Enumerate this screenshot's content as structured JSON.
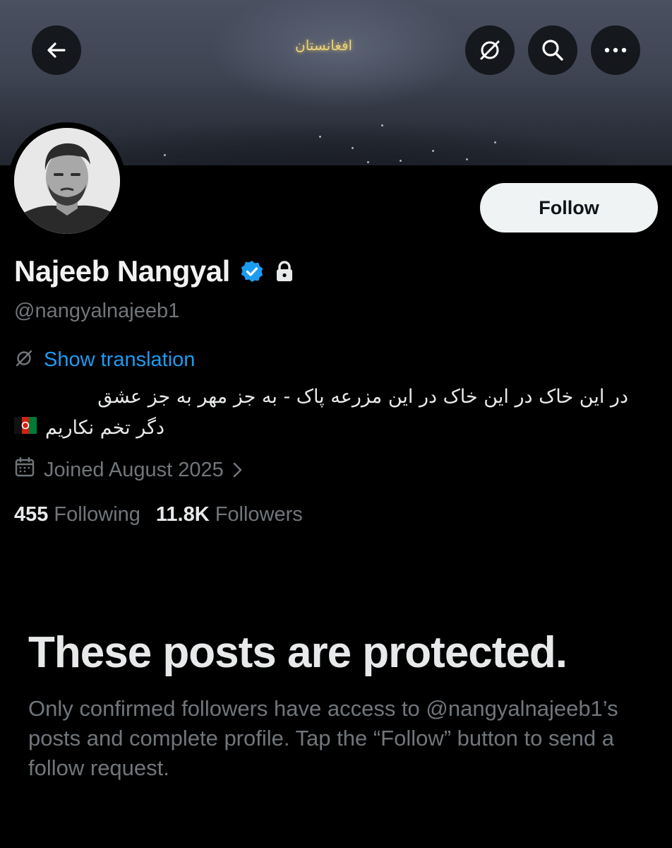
{
  "banner": {
    "text": "افغانستان",
    "buttons": {
      "back": "arrow-left-icon",
      "translate": "translate-icon",
      "search": "search-icon",
      "more": "more-icon"
    }
  },
  "profile": {
    "display_name": "Najeeb Nangyal",
    "handle": "@nangyalnajeeb1",
    "verified": true,
    "protected": true,
    "follow_label": "Follow",
    "show_translation": "Show translation",
    "bio_line1": "در این خاک در این خاک در این مزرعه پاک - به جز مهر به جز عشق",
    "bio_line2": "دگر تخم نکاریم",
    "bio_flag": "afghanistan-flag",
    "joined": "Joined August 2025",
    "following_count": "455",
    "following_label": "Following",
    "followers_count": "11.8K",
    "followers_label": "Followers"
  },
  "protected_notice": {
    "title": "These posts are protected.",
    "body": "Only confirmed followers have access to @nangyalnajeeb1’s posts and complete profile. Tap the “Follow” button to send a follow request."
  },
  "colors": {
    "background": "#000000",
    "text": "#e7e9ea",
    "secondary_text": "#71767b",
    "link": "#1d9bf0",
    "verified": "#1d9bf0",
    "follow_button_bg": "#eff3f4"
  }
}
